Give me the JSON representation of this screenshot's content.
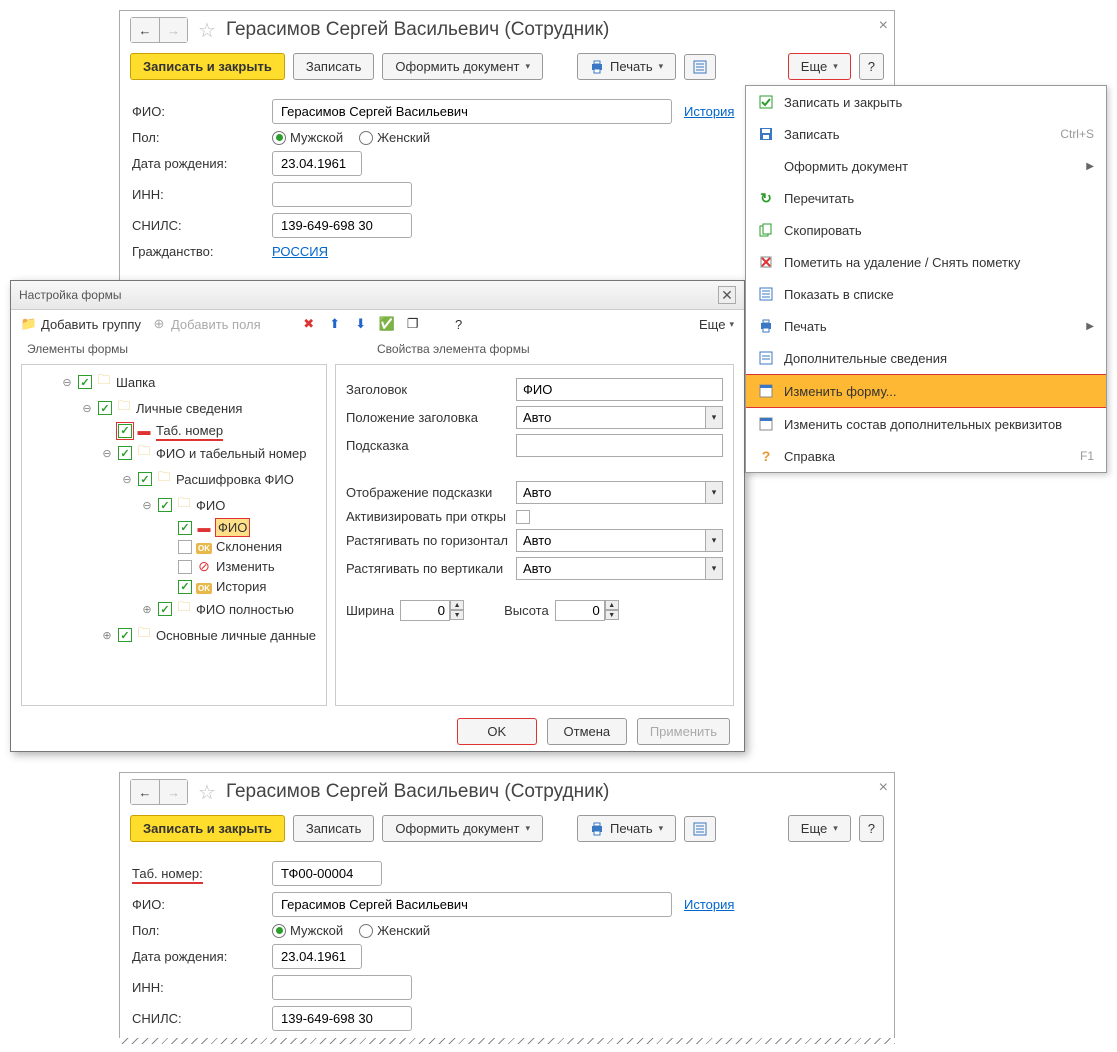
{
  "windowBefore": {
    "title": "Герасимов Сергей Васильевич (Сотрудник)",
    "toolbar": {
      "save_close": "Записать и закрыть",
      "save": "Записать",
      "make_doc": "Оформить документ",
      "print": "Печать",
      "more": "Еще",
      "help": "?"
    },
    "labels": {
      "fio": "ФИО:",
      "history": "История",
      "gender": "Пол:",
      "male": "Мужской",
      "female": "Женский",
      "birth": "Дата рождения:",
      "inn": "ИНН:",
      "snils": "СНИЛС:",
      "citizenship": "Гражданство:"
    },
    "values": {
      "fio": "Герасимов Сергей Васильевич",
      "birth": "23.04.1961",
      "inn": "",
      "snils": "139-649-698 30",
      "citizenship": "РОССИЯ"
    }
  },
  "menu": {
    "items": [
      {
        "icon": "save-close-icon",
        "label": "Записать и закрыть"
      },
      {
        "icon": "save-icon",
        "label": "Записать",
        "shortcut": "Ctrl+S"
      },
      {
        "icon": "",
        "label": "Оформить документ",
        "submenu": true
      },
      {
        "icon": "reload-icon",
        "label": "Перечитать"
      },
      {
        "icon": "copy-icon",
        "label": "Скопировать"
      },
      {
        "icon": "delete-mark-icon",
        "label": "Пометить на удаление / Снять пометку"
      },
      {
        "icon": "list-icon",
        "label": "Показать в списке"
      },
      {
        "icon": "print-icon",
        "label": "Печать",
        "submenu": true
      },
      {
        "icon": "info-icon",
        "label": "Дополнительные сведения"
      },
      {
        "icon": "form-icon",
        "label": "Изменить форму...",
        "highlight": true
      },
      {
        "icon": "form-icon",
        "label": "Изменить состав дополнительных реквизитов"
      },
      {
        "icon": "help-icon",
        "label": "Справка",
        "shortcut": "F1"
      }
    ]
  },
  "dialog": {
    "title": "Настройка формы",
    "toolbar": {
      "add_group": "Добавить группу",
      "add_fields": "Добавить поля",
      "more": "Еще",
      "help": "?"
    },
    "left_header": "Элементы формы",
    "right_header": "Свойства элемента формы",
    "tree": [
      {
        "level": 0,
        "expand": "⊖",
        "checked": true,
        "icon": "folder",
        "label": "Шапка"
      },
      {
        "level": 1,
        "expand": "⊖",
        "checked": true,
        "icon": "folder",
        "label": "Личные сведения"
      },
      {
        "level": 2,
        "expand": "",
        "checked": true,
        "checked_red": true,
        "icon": "bar",
        "label": "Таб. номер",
        "label_red_ul": true
      },
      {
        "level": 2,
        "expand": "⊖",
        "checked": true,
        "icon": "folder",
        "label": "ФИО и табельный номер"
      },
      {
        "level": 3,
        "expand": "⊖",
        "checked": true,
        "icon": "folder",
        "label": "Расшифровка ФИО"
      },
      {
        "level": 4,
        "expand": "⊖",
        "checked": true,
        "icon": "folder",
        "label": "ФИО"
      },
      {
        "level": 5,
        "expand": "",
        "checked": true,
        "icon": "bar",
        "label": "ФИО",
        "selected": true
      },
      {
        "level": 5,
        "expand": "",
        "checked": false,
        "icon": "ok",
        "label": "Склонения"
      },
      {
        "level": 5,
        "expand": "",
        "checked": false,
        "icon": "cross",
        "label": "Изменить"
      },
      {
        "level": 5,
        "expand": "",
        "checked": true,
        "icon": "ok",
        "label": "История"
      },
      {
        "level": 4,
        "expand": "⊕",
        "checked": true,
        "icon": "folder",
        "label": "ФИО полностью"
      },
      {
        "level": 2,
        "expand": "⊕",
        "checked": true,
        "icon": "folder",
        "label": "Основные личные данные"
      }
    ],
    "props": {
      "title_label": "Заголовок",
      "title_value": "ФИО",
      "title_pos_label": "Положение заголовка",
      "title_pos_value": "Авто",
      "hint_label": "Подсказка",
      "hint_value": "",
      "hint_display_label": "Отображение подсказки",
      "hint_display_value": "Авто",
      "activate_label": "Активизировать при откры",
      "stretch_h_label": "Растягивать по горизонтал",
      "stretch_h_value": "Авто",
      "stretch_v_label": "Растягивать по вертикали",
      "stretch_v_value": "Авто",
      "width_label": "Ширина",
      "width_value": "0",
      "height_label": "Высота",
      "height_value": "0"
    },
    "buttons": {
      "ok": "OK",
      "cancel": "Отмена",
      "apply": "Применить"
    }
  },
  "windowAfter": {
    "title": "Герасимов Сергей Васильевич (Сотрудник)",
    "labels": {
      "tabnum": "Таб. номер:",
      "fio": "ФИО:",
      "history": "История",
      "gender": "Пол:",
      "male": "Мужской",
      "female": "Женский",
      "birth": "Дата рождения:",
      "inn": "ИНН:",
      "snils": "СНИЛС:"
    },
    "values": {
      "tabnum": "ТФ00-00004",
      "fio": "Герасимов Сергей Васильевич",
      "birth": "23.04.1961",
      "inn": "",
      "snils": "139-649-698 30"
    }
  }
}
